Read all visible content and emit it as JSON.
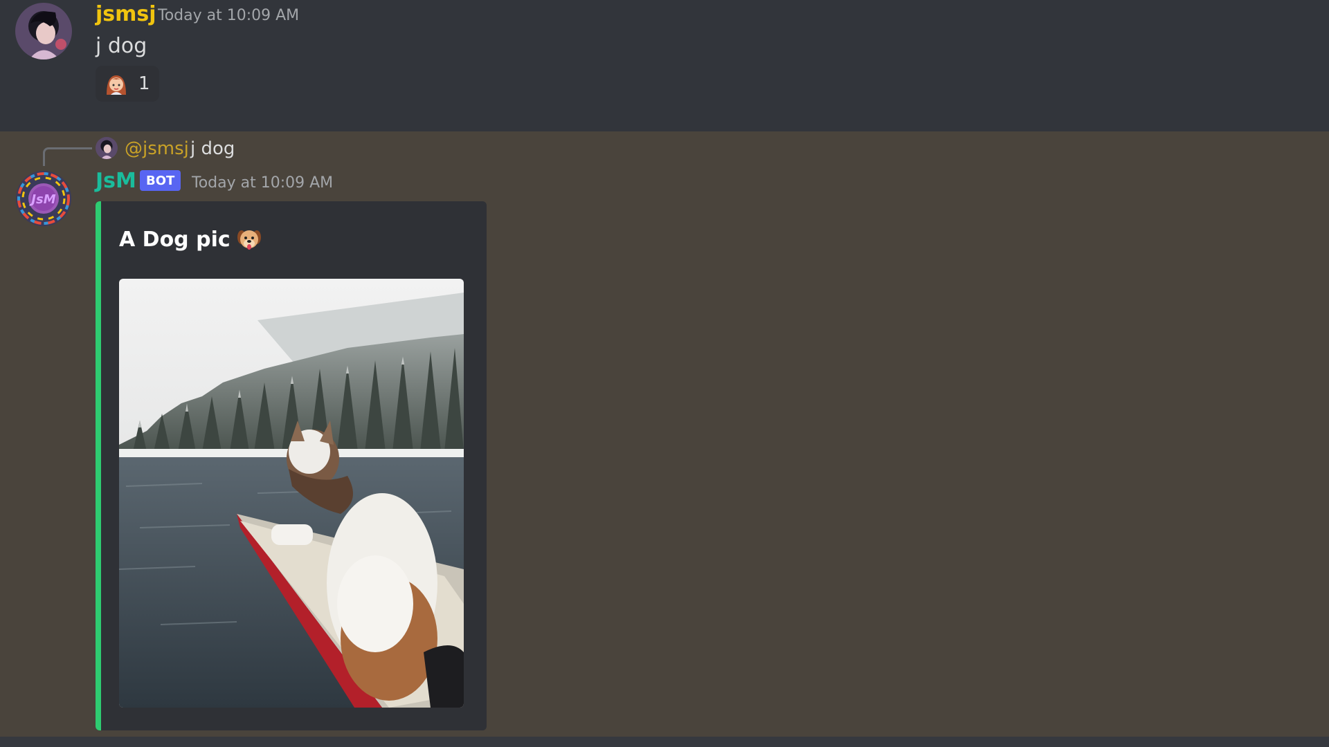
{
  "messages": [
    {
      "author": "jsmsj",
      "author_color": "#f1c40f",
      "timestamp": "Today at 10:09 AM",
      "content": "j dog",
      "reaction": {
        "emoji": "girl-face-emoji",
        "count": "1"
      }
    },
    {
      "reply": {
        "mention": "@jsmsj",
        "text": "j dog"
      },
      "author": "JsM",
      "author_color": "#1abc9c",
      "badge": "BOT",
      "timestamp": "Today at 10:09 AM",
      "embed": {
        "title": "A Dog pic",
        "title_emoji": "dog-face-emoji",
        "accent_color": "#2ecc71",
        "image": "dog-in-canoe-snowy-lake"
      }
    }
  ]
}
